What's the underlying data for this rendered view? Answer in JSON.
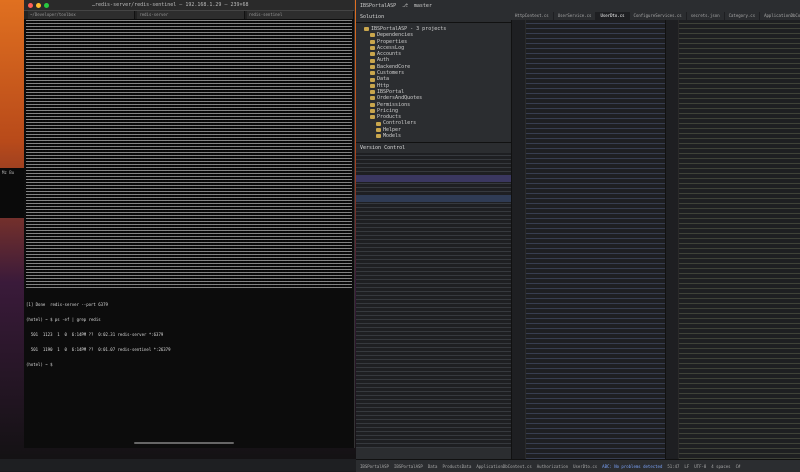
{
  "terminal": {
    "tabs": [
      "~/Developer/toolbox",
      "redis-server",
      "redis-sentinel"
    ],
    "title": "…redis-server/redis-sentinel — 192.168.1.29 — 239×68",
    "tail_lines": [
      "[1] Done  redis-server --port 6379",
      "(hotel) ~ $ ps -ef | grep redis",
      "  501  1123  1  0  6:14PM ??  0:02.31 redis-server *:6379",
      "  501  1190  1  0  6:14PM ??  0:01.07 redis-sentinel *:26379",
      "(hotel) ~ $"
    ],
    "side_label": "Mz Bu"
  },
  "ide": {
    "project": "IBSPortalASP",
    "branch": "master",
    "explorer_title": "Solution",
    "root_label": "IBSPortalASP - 3 projects",
    "tree": [
      "Dependencies",
      "Properties",
      "AccessLog",
      "Accounts",
      "Auth",
      "BackendCore",
      "Customers",
      "Data",
      "Http",
      "IBSPortal",
      "OrdersAndQuotes",
      "Permissions",
      "Pricing",
      "Products",
      "Controllers",
      "Helper",
      "Models"
    ],
    "vcs_title": "Version Control",
    "tabs": [
      "HttpContext.cs",
      "UserService.cs",
      "UserDto.cs",
      "ConfigureServices.cs",
      "secrets.json",
      "Category.cs",
      "ApplicationDbContext.cs"
    ],
    "status": [
      "IBSPortalASP",
      "IBSPortalASP",
      "Data",
      "ProductsData",
      "ApplicationDbContext.cs",
      "Authorization",
      "UserDto.cs",
      "ABC: No problems detected",
      "51:47",
      "LF",
      "UTF-8",
      "4 spaces",
      "C#"
    ]
  }
}
